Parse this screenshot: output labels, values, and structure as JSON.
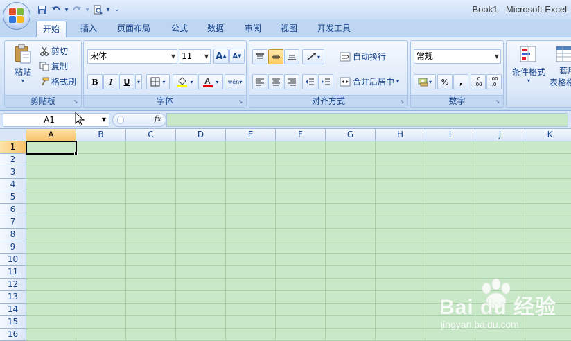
{
  "window": {
    "title": "Book1 - Microsoft Excel"
  },
  "tabs": [
    {
      "label": "开始",
      "active": true
    },
    {
      "label": "插入"
    },
    {
      "label": "页面布局"
    },
    {
      "label": "公式"
    },
    {
      "label": "数据"
    },
    {
      "label": "审阅"
    },
    {
      "label": "视图"
    },
    {
      "label": "开发工具"
    }
  ],
  "clipboard": {
    "paste": "粘贴",
    "cut": "剪切",
    "copy": "复制",
    "format_painter": "格式刷",
    "label": "剪贴板"
  },
  "font": {
    "name": "宋体",
    "size": "11",
    "label": "字体",
    "bold": "B",
    "italic": "I",
    "underline": "U",
    "grow": "A",
    "shrink": "A",
    "phonetic": "wén"
  },
  "alignment": {
    "wrap": "自动换行",
    "merge": "合并后居中",
    "label": "对齐方式"
  },
  "number": {
    "format": "常规",
    "percent": "%",
    "comma": ",",
    "inc_dec": ".0 .00",
    "dec_dec": ".00 .0",
    "label": "数字"
  },
  "styles": {
    "conditional": "条件格式",
    "table_line1": "套用",
    "table_line2": "表格格"
  },
  "formula_bar": {
    "name_box": "A1",
    "fx": "fx"
  },
  "grid": {
    "columns": [
      "A",
      "B",
      "C",
      "D",
      "E",
      "F",
      "G",
      "H",
      "I",
      "J",
      "K"
    ],
    "rows": [
      "1",
      "2",
      "3",
      "4",
      "5",
      "6",
      "7",
      "8",
      "9",
      "10",
      "11",
      "12",
      "13",
      "14",
      "15",
      "16"
    ],
    "selected_column": "A",
    "selected_row": "1"
  },
  "watermark": {
    "logo": "Bai du 经验",
    "url": "jingyan.baidu.com"
  },
  "colors": {
    "sheet_bg": "#c8e8c8",
    "ribbon_blue": "#dbe8f9",
    "tab_text": "#15428b"
  }
}
